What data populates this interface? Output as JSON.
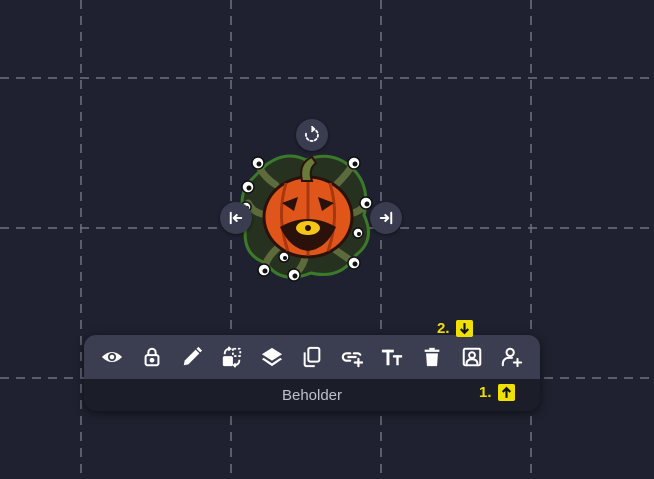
{
  "token": {
    "name": "Beholder",
    "image": "pumpkin-beholder-token"
  },
  "handles": {
    "rotate": "rotate-icon",
    "resize_left": "resize-left-icon",
    "resize_right": "resize-right-icon"
  },
  "toolbar": {
    "buttons": [
      {
        "name": "visibility",
        "icon": "eye-icon"
      },
      {
        "name": "lock",
        "icon": "lock-icon"
      },
      {
        "name": "edit",
        "icon": "pencil-icon"
      },
      {
        "name": "swap",
        "icon": "swap-icon"
      },
      {
        "name": "layers",
        "icon": "layers-icon"
      },
      {
        "name": "duplicate",
        "icon": "copy-icon"
      },
      {
        "name": "link",
        "icon": "link-add-icon"
      },
      {
        "name": "text",
        "icon": "text-size-icon"
      },
      {
        "name": "delete",
        "icon": "trash-icon"
      },
      {
        "name": "portrait",
        "icon": "portrait-icon"
      },
      {
        "name": "add-user",
        "icon": "user-plus-icon"
      }
    ]
  },
  "annotations": [
    {
      "label": "2.",
      "icon": "arrow-down-icon"
    },
    {
      "label": "1.",
      "icon": "arrow-up-icon"
    }
  ],
  "colors": {
    "background": "#1f2130",
    "grid_line": "#8a8d98",
    "toolbar_top": "#3b3e50",
    "toolbar_bottom": "#1b1d29",
    "annotation": "#f0e000"
  }
}
